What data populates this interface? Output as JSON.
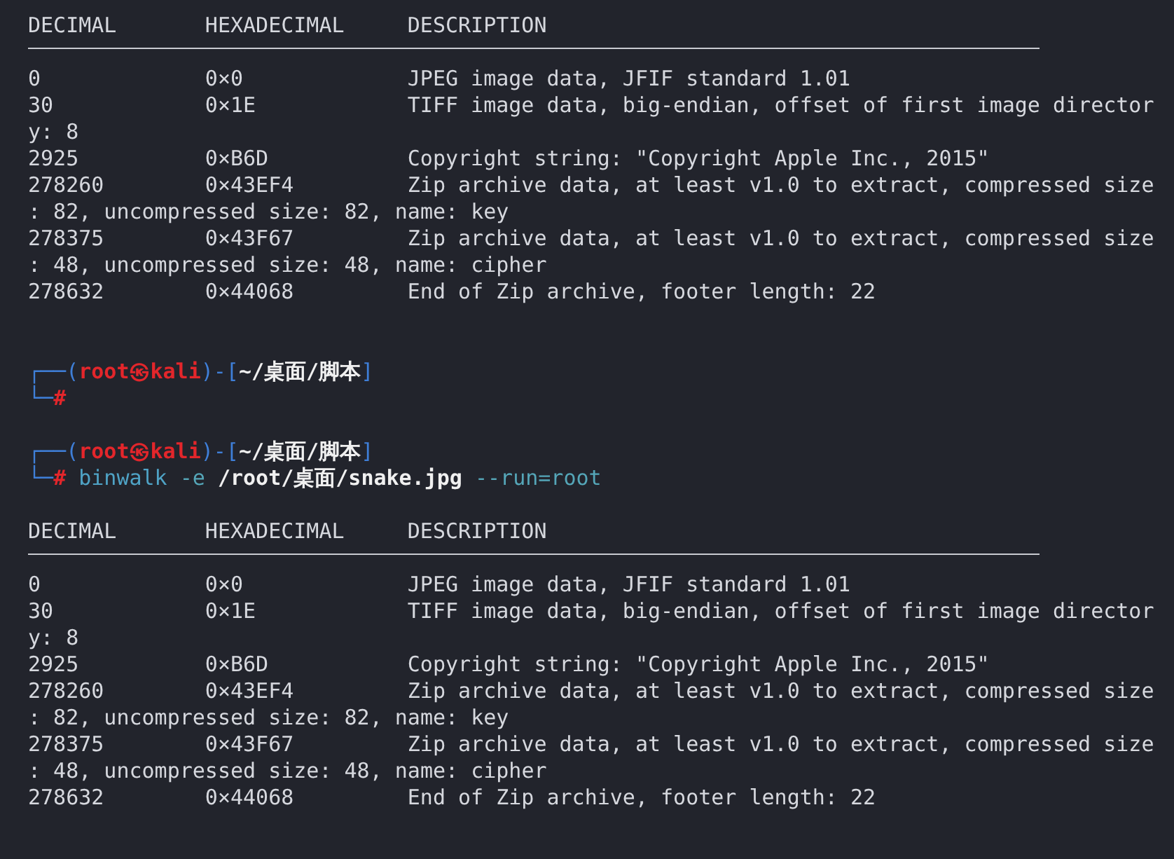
{
  "terminal": {
    "blocks": [
      {
        "kind": "table",
        "columns": [
          "DECIMAL",
          "HEXADECIMAL",
          "DESCRIPTION"
        ],
        "rows": [
          {
            "decimal": "0",
            "hex": "0×0",
            "description": "JPEG image data, JFIF standard 1.01"
          },
          {
            "decimal": "30",
            "hex": "0×1E",
            "description": "TIFF image data, big-endian, offset of first image director",
            "continuation": "y: 8"
          },
          {
            "decimal": "2925",
            "hex": "0×B6D",
            "description": "Copyright string: \"Copyright Apple Inc., 2015\""
          },
          {
            "decimal": "278260",
            "hex": "0×43EF4",
            "description": "Zip archive data, at least v1.0 to extract, compressed size",
            "continuation": ": 82, uncompressed size: 82, name: key"
          },
          {
            "decimal": "278375",
            "hex": "0×43F67",
            "description": "Zip archive data, at least v1.0 to extract, compressed size",
            "continuation": ": 48, uncompressed size: 48, name: cipher"
          },
          {
            "decimal": "278632",
            "hex": "0×44068",
            "description": "End of Zip archive, footer length: 22"
          }
        ]
      },
      {
        "kind": "prompt",
        "line1": [
          {
            "kind": "frame",
            "text": "┌──("
          },
          {
            "kind": "user",
            "text": "root㉿kali"
          },
          {
            "kind": "frame",
            "text": ")-["
          },
          {
            "kind": "path",
            "text": "~/桌面/脚本"
          },
          {
            "kind": "frame",
            "text": "]"
          }
        ],
        "line2": [
          {
            "kind": "frame",
            "text": "└─"
          },
          {
            "kind": "hash",
            "text": "#"
          }
        ]
      },
      {
        "kind": "prompt",
        "line1": [
          {
            "kind": "frame",
            "text": "┌──("
          },
          {
            "kind": "user",
            "text": "root㉿kali"
          },
          {
            "kind": "frame",
            "text": ")-["
          },
          {
            "kind": "path",
            "text": "~/桌面/脚本"
          },
          {
            "kind": "frame",
            "text": "]"
          }
        ],
        "line2": [
          {
            "kind": "frame",
            "text": "└─"
          },
          {
            "kind": "hash",
            "text": "#"
          },
          {
            "kind": "program",
            "text": "binwalk"
          },
          {
            "kind": "option",
            "text": "-e"
          },
          {
            "kind": "path",
            "text": "/root/桌面/snake.jpg"
          },
          {
            "kind": "option",
            "text": "--run=root"
          }
        ]
      },
      {
        "kind": "table",
        "columns": [
          "DECIMAL",
          "HEXADECIMAL",
          "DESCRIPTION"
        ],
        "rows": [
          {
            "decimal": "0",
            "hex": "0×0",
            "description": "JPEG image data, JFIF standard 1.01"
          },
          {
            "decimal": "30",
            "hex": "0×1E",
            "description": "TIFF image data, big-endian, offset of first image director",
            "continuation": "y: 8"
          },
          {
            "decimal": "2925",
            "hex": "0×B6D",
            "description": "Copyright string: \"Copyright Apple Inc., 2015\""
          },
          {
            "decimal": "278260",
            "hex": "0×43EF4",
            "description": "Zip archive data, at least v1.0 to extract, compressed size",
            "continuation": ": 82, uncompressed size: 82, name: key"
          },
          {
            "decimal": "278375",
            "hex": "0×43F67",
            "description": "Zip archive data, at least v1.0 to extract, compressed size",
            "continuation": ": 48, uncompressed size: 48, name: cipher"
          },
          {
            "decimal": "278632",
            "hex": "0×44068",
            "description": "End of Zip archive, footer length: 22"
          }
        ]
      }
    ]
  }
}
